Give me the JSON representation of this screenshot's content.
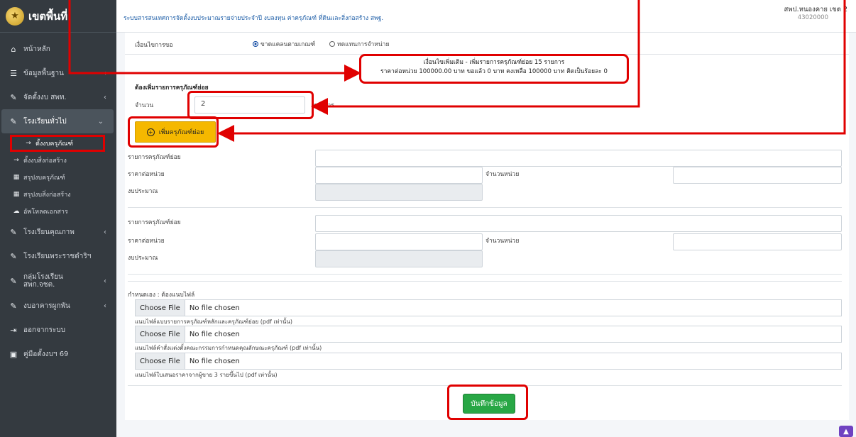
{
  "brand": {
    "name": "เขตพื้นที่"
  },
  "header": {
    "system_title": "ระบบสารสนเทศการจัดตั้งงบประมาณรายจ่ายประจำปี งบลงทุน ค่าครุภัณฑ์ ที่ดินและสิ่งก่อสร้าง สพฐ.",
    "office_name": "สพป.หนองคาย เขต 2",
    "office_code": "43020000"
  },
  "sidebar": {
    "items": [
      {
        "label": "หน้าหลัก",
        "icon": "home-icon"
      },
      {
        "label": "ข้อมูลพื้นฐาน",
        "icon": "sliders-icon"
      },
      {
        "label": "จัดตั้งงบ สพท.",
        "icon": "edit-icon"
      },
      {
        "label": "โรงเรียนทั่วไป",
        "icon": "edit-icon"
      },
      {
        "label": "ตั้งงบครุภัณฑ์",
        "icon": "arrow-icon"
      },
      {
        "label": "ตั้งงบสิ่งก่อสร้าง",
        "icon": "arrow-icon"
      },
      {
        "label": "สรุปงบครุภัณฑ์",
        "icon": "table-icon"
      },
      {
        "label": "สรุปงบสิ่งก่อสร้าง",
        "icon": "table-icon"
      },
      {
        "label": "อัพโหลดเอกสาร",
        "icon": "upload-icon"
      },
      {
        "label": "โรงเรียนคุณภาพ",
        "icon": "edit-icon"
      },
      {
        "label": "โรงเรียนพระราชดำริฯ",
        "icon": "edit-icon"
      },
      {
        "label": "กลุ่มโรงเรียน",
        "icon": "edit-icon"
      },
      {
        "label": "สพก.จชต.",
        "icon": ""
      },
      {
        "label": "งบอาคารผูกพัน",
        "icon": "edit-icon"
      },
      {
        "label": "ออกจากระบบ",
        "icon": "logout-icon"
      },
      {
        "label": "คู่มือตั้งงบฯ 69",
        "icon": "book-icon"
      }
    ]
  },
  "form": {
    "condition_label": "เงื่อนไขการขอ",
    "radio1": "ขาดแคลนตามเกณฑ์",
    "radio2": "ทดแทนการจำหน่าย",
    "notice_line1": "เงื่อนไขเพิ่มเติม - เพิ่มรายการครุภัณฑ์ย่อย 15 รายการ",
    "notice_line2": "ราคาต่อหน่วย 100000.00 บาท ขอแล้ว 0 บาท คงเหลือ 100000 บาท คิดเป็นร้อยละ 0",
    "section_title": "ต้องเพิ่มรายการครุภัณฑ์ย่อย",
    "qty_label": "จำนวน",
    "qty_value": "2",
    "qty_unit": "รายการ",
    "add_button": "เพิ่มครุภัณฑ์ย่อย",
    "item_label": "รายการครุภัณฑ์ย่อย",
    "price_label": "ราคาต่อหน่วย",
    "units_label": "จำนวนหน่วย",
    "budget_label": "งบประมาณ",
    "custom_label": "กำหนดเอง : ต้องแนบไฟล์",
    "choose_file": "Choose File",
    "no_file": "No file chosen",
    "hint1": "แนบไฟล์แบบรายการครุภัณฑ์หลักและครุภัณฑ์ย่อย (pdf เท่านั้น)",
    "hint2": "แนบไฟล์คำสั่งแต่งตั้งคณะกรรมการกำหนดคุณลักษณะครุภัณฑ์ (pdf เท่านั้น)",
    "hint3": "แนบไฟล์ใบเสนอราคาจากผู้ขาย 3 รายขึ้นไป (pdf เท่านั้น)",
    "save_button": "บันทึกข้อมูล"
  },
  "colors": {
    "highlight": "#e00000",
    "sidebar": "#343a40",
    "add_button": "#f5b800",
    "save_button": "#28a745"
  }
}
